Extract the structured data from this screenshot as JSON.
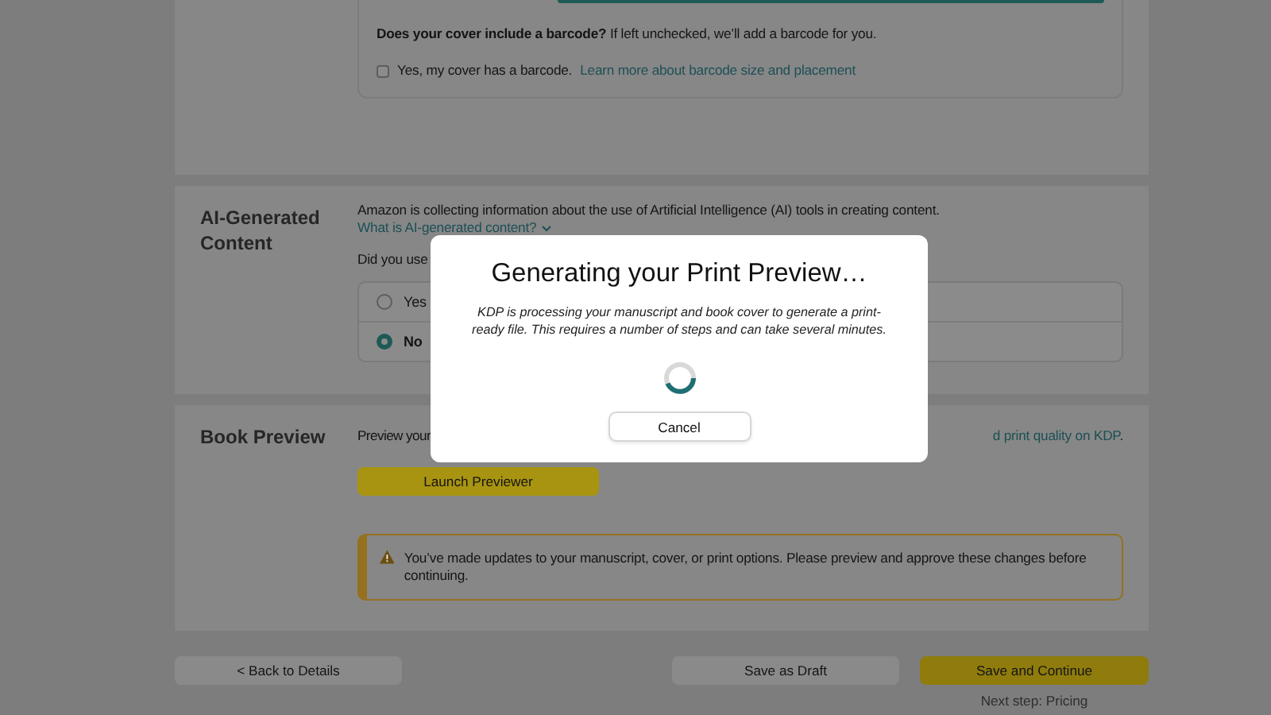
{
  "cover_barcode": {
    "question": "**Does your cover include a barcode?** If left unchecked, we’ll add a barcode for you.",
    "checkbox": {
      "label": "Yes, my cover has a barcode.",
      "checked": false
    },
    "link": "Learn more about barcode size and placement"
  },
  "ai_section": {
    "title": "AI-Generated Content",
    "intro": "Amazon is collecting information about the use of Artificial Intelligence (AI) tools in creating content.",
    "link": "What is AI-generated content?",
    "question": "Did you use",
    "options": [
      {
        "label": "Yes",
        "selected": false
      },
      {
        "label": "No",
        "selected": true
      }
    ]
  },
  "book_preview": {
    "title": "Book Preview",
    "text_start": "Preview your",
    "link_end": "d print quality on KDP",
    "text_end": ".",
    "button": "Launch Previewer",
    "warning": "You’ve made updates to your manuscript, cover, or print options. Please preview and approve these changes before continuing."
  },
  "footer": {
    "back": "< Back to Details",
    "draft": "Save as Draft",
    "continue": "Save and Continue",
    "next_step": "Next step: Pricing"
  },
  "modal": {
    "title": "Generating your Print Preview…",
    "message": "KDP is processing your manuscript and book cover to generate a print-ready file. This requires a number of steps and can take several minutes.",
    "button": "Cancel"
  }
}
